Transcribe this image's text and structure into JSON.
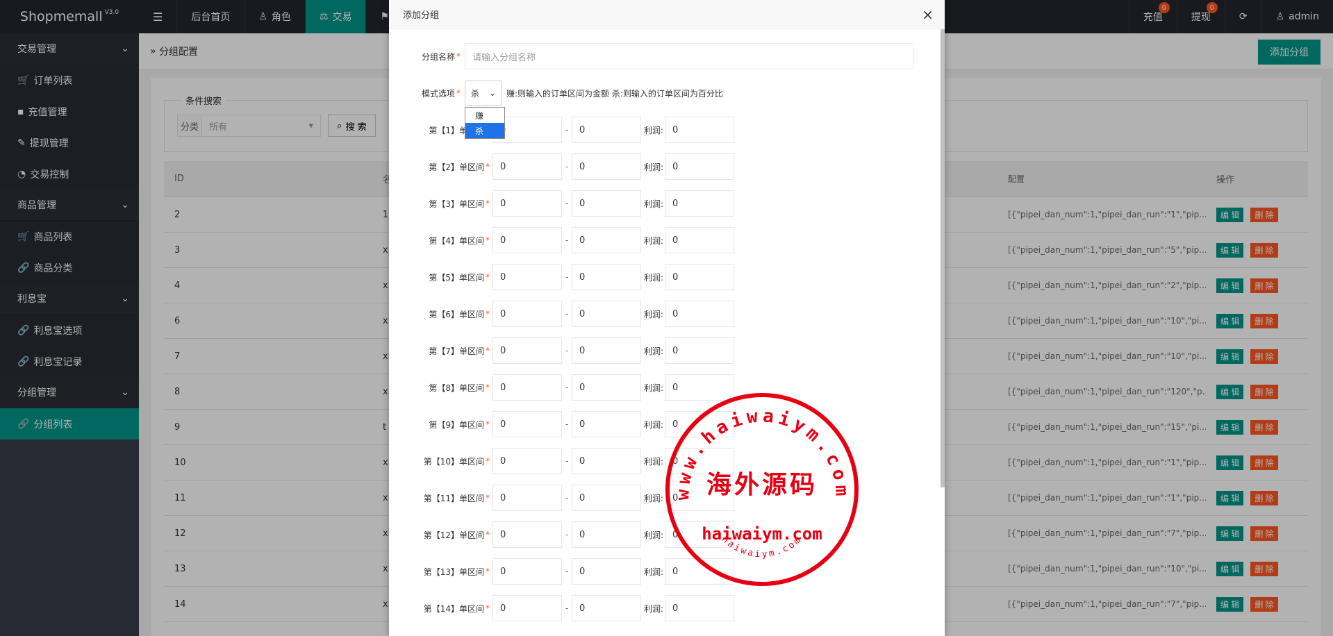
{
  "app": {
    "name": "Shopmemall",
    "version": "V3.0"
  },
  "topnav": {
    "menu_icon": "hamburger-icon",
    "items": [
      {
        "label": "后台首页",
        "icon": ""
      },
      {
        "label": "角色",
        "icon": "user-icon"
      },
      {
        "label": "交易",
        "icon": "balance-scale-icon",
        "active": true
      },
      {
        "label": "",
        "icon": "flag-icon"
      }
    ],
    "right": {
      "recharge": {
        "label": "充值",
        "badge": "0"
      },
      "withdraw": {
        "label": "提现",
        "badge": "0"
      },
      "refresh_icon": "refresh-icon",
      "user": "admin"
    }
  },
  "sidebar": {
    "groups": [
      {
        "label": "交易管理",
        "items": [
          "订单列表",
          "充值管理",
          "提现管理",
          "交易控制"
        ]
      },
      {
        "label": "商品管理",
        "items": [
          "商品列表",
          "商品分类"
        ]
      },
      {
        "label": "利息宝",
        "items": [
          "利息宝选项",
          "利息宝记录"
        ]
      },
      {
        "label": "分组管理",
        "items": [
          "分组列表"
        ]
      }
    ],
    "active": "分组列表"
  },
  "page": {
    "breadcrumb": "分组配置",
    "add_button": "添加分组",
    "search": {
      "legend": "条件搜索",
      "category_label": "分类",
      "category_value": "所有",
      "search_button": "搜 索"
    },
    "table": {
      "headers": {
        "id": "ID",
        "name": "名",
        "config": "配置",
        "ops": "操作"
      },
      "rows": [
        {
          "id": "2",
          "name": "1",
          "config": "[{\"pipei_dan_num\":1,\"pipei_dan_run\":\"1\",\"pip..."
        },
        {
          "id": "3",
          "name": "x",
          "config": "[{\"pipei_dan_num\":1,\"pipei_dan_run\":\"5\",\"pip..."
        },
        {
          "id": "4",
          "name": "x",
          "config": "[{\"pipei_dan_num\":1,\"pipei_dan_run\":\"2\",\"pip..."
        },
        {
          "id": "6",
          "name": "x",
          "config": "[{\"pipei_dan_num\":1,\"pipei_dan_run\":\"10\",\"pi..."
        },
        {
          "id": "7",
          "name": "x",
          "config": "[{\"pipei_dan_num\":1,\"pipei_dan_run\":\"10\",\"pi..."
        },
        {
          "id": "8",
          "name": "x",
          "config": "[{\"pipei_dan_num\":1,\"pipei_dan_run\":\"120\",\"p..."
        },
        {
          "id": "9",
          "name": "t",
          "config": "[{\"pipei_dan_num\":1,\"pipei_dan_run\":\"15\",\"pi..."
        },
        {
          "id": "10",
          "name": "x",
          "config": "[{\"pipei_dan_num\":1,\"pipei_dan_run\":\"1\",\"pip..."
        },
        {
          "id": "11",
          "name": "x",
          "config": "[{\"pipei_dan_num\":1,\"pipei_dan_run\":\"1\",\"pip..."
        },
        {
          "id": "12",
          "name": "x",
          "config": "[{\"pipei_dan_num\":1,\"pipei_dan_run\":\"7\",\"pip..."
        },
        {
          "id": "13",
          "name": "x",
          "config": "[{\"pipei_dan_num\":1,\"pipei_dan_run\":\"10\",\"pi..."
        },
        {
          "id": "14",
          "name": "x",
          "config": "[{\"pipei_dan_num\":1,\"pipei_dan_run\":\"7\",\"pip..."
        }
      ],
      "edit_label": "编 辑",
      "delete_label": "删 除"
    }
  },
  "modal": {
    "title": "添加分组",
    "name_label": "分组名称",
    "name_placeholder": "请输入分组名称",
    "mode_label": "模式选项",
    "mode_value": "杀",
    "mode_hint": "赚:则输入的订单区间为金额 杀:则输入的订单区间为百分比",
    "mode_options": [
      "赚",
      "杀"
    ],
    "profit_label": "利润:",
    "ranges": [
      {
        "label": "第【1】单区间",
        "from": "0",
        "to": "0",
        "profit": "0"
      },
      {
        "label": "第【2】单区间",
        "from": "0",
        "to": "0",
        "profit": "0"
      },
      {
        "label": "第【3】单区间",
        "from": "0",
        "to": "0",
        "profit": "0"
      },
      {
        "label": "第【4】单区间",
        "from": "0",
        "to": "0",
        "profit": "0"
      },
      {
        "label": "第【5】单区间",
        "from": "0",
        "to": "0",
        "profit": "0"
      },
      {
        "label": "第【6】单区间",
        "from": "0",
        "to": "0",
        "profit": "0"
      },
      {
        "label": "第【7】单区间",
        "from": "0",
        "to": "0",
        "profit": "0"
      },
      {
        "label": "第【8】单区间",
        "from": "0",
        "to": "0",
        "profit": "0"
      },
      {
        "label": "第【9】单区间",
        "from": "0",
        "to": "0",
        "profit": "0"
      },
      {
        "label": "第【10】单区间",
        "from": "0",
        "to": "0",
        "profit": "0"
      },
      {
        "label": "第【11】单区间",
        "from": "0",
        "to": "0",
        "profit": "0"
      },
      {
        "label": "第【12】单区间",
        "from": "0",
        "to": "0",
        "profit": "0"
      },
      {
        "label": "第【13】单区间",
        "from": "0",
        "to": "0",
        "profit": "0"
      },
      {
        "label": "第【14】单区间",
        "from": "0",
        "to": "0",
        "profit": "0"
      }
    ]
  },
  "watermark": {
    "top_text": "www.haiwaiym.com",
    "center_text": "海外源码",
    "middle_text": "haiwaiym.com",
    "bottom_text": "haiwaiym.com",
    "color": "#e60012"
  }
}
